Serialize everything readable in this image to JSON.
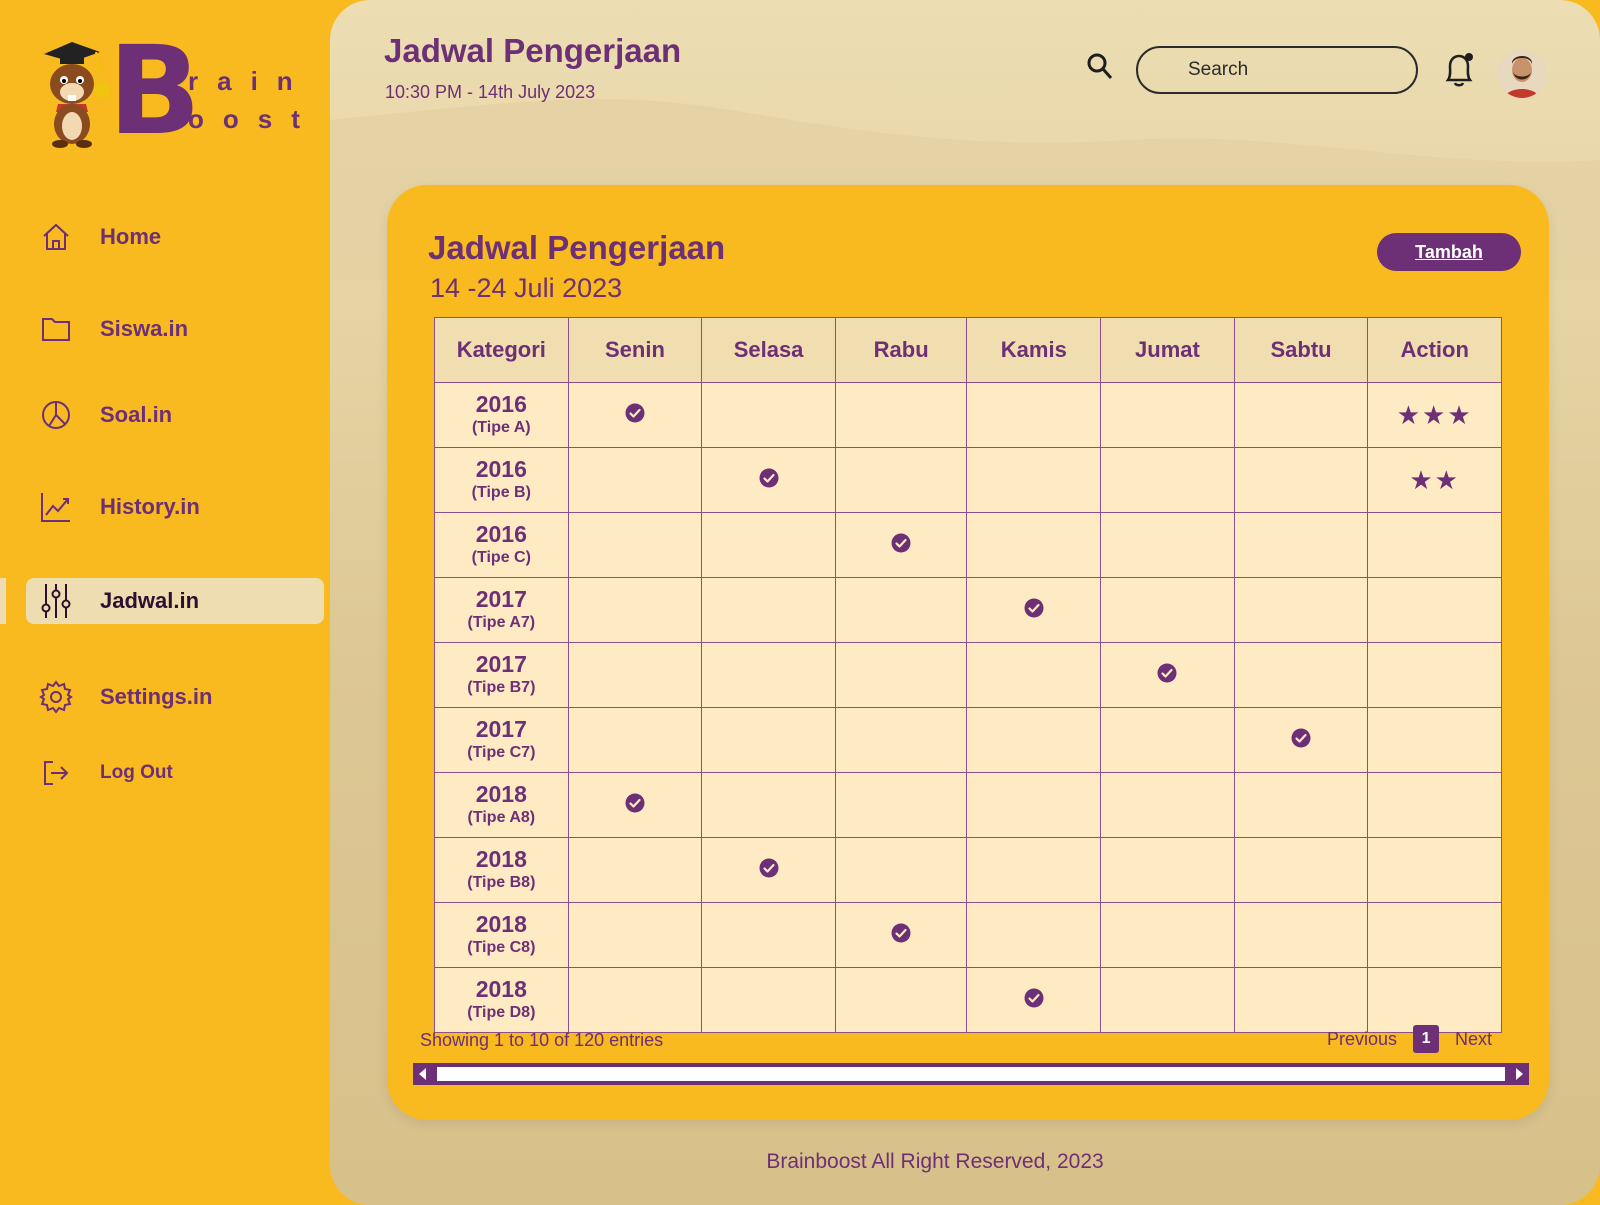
{
  "logo": {
    "letter": "B",
    "line1": "rain",
    "line2": "oost"
  },
  "sidebar": {
    "items": [
      {
        "label": "Home",
        "icon": "home-icon"
      },
      {
        "label": "Siswa.in",
        "icon": "folder-icon"
      },
      {
        "label": "Soal.in",
        "icon": "pie-chart-icon"
      },
      {
        "label": "History.in",
        "icon": "line-chart-icon"
      },
      {
        "label": "Jadwal.in",
        "icon": "sliders-icon",
        "active": true
      },
      {
        "label": "Settings.in",
        "icon": "gear-icon"
      },
      {
        "label": "Log Out",
        "icon": "logout-icon"
      }
    ]
  },
  "header": {
    "title": "Jadwal Pengerjaan",
    "subtitle": "10:30 PM - 14th July 2023",
    "search_placeholder": "Search"
  },
  "card": {
    "title": "Jadwal Pengerjaan",
    "subtitle": "14 -24 Juli 2023",
    "add_label": "Tambah"
  },
  "table": {
    "columns": [
      "Kategori",
      "Senin",
      "Selasa",
      "Rabu",
      "Kamis",
      "Jumat",
      "Sabtu",
      "Action"
    ],
    "rows": [
      {
        "year": "2016",
        "type": "(Tipe A)",
        "day": 1,
        "action": "★★★"
      },
      {
        "year": "2016",
        "type": "(Tipe B)",
        "day": 2,
        "action": "★★"
      },
      {
        "year": "2016",
        "type": "(Tipe C)",
        "day": 3,
        "action": ""
      },
      {
        "year": "2017",
        "type": "(Tipe A7)",
        "day": 4,
        "action": ""
      },
      {
        "year": "2017",
        "type": "(Tipe B7)",
        "day": 5,
        "action": ""
      },
      {
        "year": "2017",
        "type": "(Tipe C7)",
        "day": 6,
        "action": ""
      },
      {
        "year": "2018",
        "type": "(Tipe A8)",
        "day": 1,
        "action": ""
      },
      {
        "year": "2018",
        "type": "(Tipe B8)",
        "day": 2,
        "action": ""
      },
      {
        "year": "2018",
        "type": "(Tipe C8)",
        "day": 3,
        "action": ""
      },
      {
        "year": "2018",
        "type": "(Tipe D8)",
        "day": 4,
        "action": ""
      }
    ]
  },
  "pagination": {
    "showing": "Showing 1 to 10 of 120 entries",
    "prev": "Previous",
    "page": "1",
    "next": "Next"
  },
  "footer": {
    "text": "Brainboost All Right Reserved, 2023"
  },
  "colors": {
    "accent": "#6D2F75",
    "yellow": "#F8BA1E",
    "cell": "#FEEBC4"
  }
}
